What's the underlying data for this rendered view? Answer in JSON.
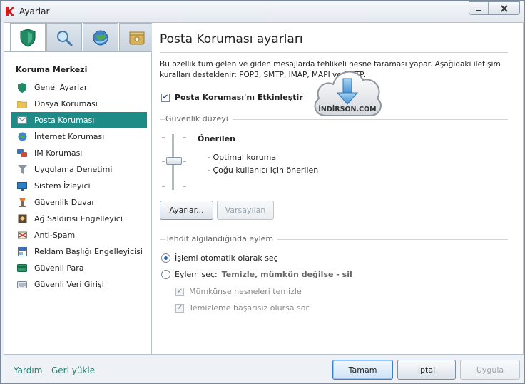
{
  "window": {
    "title": "Ayarlar"
  },
  "sidebar": {
    "section_title": "Koruma Merkezi",
    "items": [
      {
        "label": "Genel Ayarlar",
        "icon": "shield-icon"
      },
      {
        "label": "Dosya Koruması",
        "icon": "folder-icon"
      },
      {
        "label": "Posta Koruması",
        "icon": "mail-icon"
      },
      {
        "label": "İnternet Koruması",
        "icon": "globe-icon"
      },
      {
        "label": "IM Koruması",
        "icon": "chat-icon"
      },
      {
        "label": "Uygulama Denetimi",
        "icon": "funnel-icon"
      },
      {
        "label": "Sistem İzleyici",
        "icon": "monitor-icon"
      },
      {
        "label": "Güvenlik Duvarı",
        "icon": "firewall-icon"
      },
      {
        "label": "Ağ Saldırısı Engelleyici",
        "icon": "network-icon"
      },
      {
        "label": "Anti-Spam",
        "icon": "antispam-icon"
      },
      {
        "label": "Reklam Başlığı Engelleyicisi",
        "icon": "ad-block-icon"
      },
      {
        "label": "Güvenli Para",
        "icon": "money-icon"
      },
      {
        "label": "Güvenli Veri Girişi",
        "icon": "keyboard-icon"
      }
    ],
    "active_index": 2
  },
  "main": {
    "title": "Posta Koruması ayarları",
    "description": "Bu özellik tüm gelen ve giden mesajlarda tehlikeli nesne taraması yapar. Aşağıdaki iletişim kuralları desteklenir: POP3, SMTP, IMAP, MAPI ve NNTP.",
    "enable_label": "Posta Koruması'nı Etkinleştir",
    "security_group": "Güvenlik düzeyi",
    "level_name": "Önerilen",
    "level_lines": [
      "- Optimal koruma",
      "- Çoğu kullanıcı için önerilen"
    ],
    "settings_button": "Ayarlar...",
    "default_button": "Varsayılan",
    "threat_group": "Tehdit algılandığında eylem",
    "radio_auto": "İşlemi otomatik olarak seç",
    "radio_select": "Eylem seç:",
    "radio_select_value": "Temizle, mümkün değilse - sil",
    "sub_check_1": "Mümkünse nesneleri temizle",
    "sub_check_2": "Temizleme başarısız olursa sor"
  },
  "watermark": {
    "text": "İNDİRSON.COM"
  },
  "footer": {
    "help": "Yardım",
    "restore": "Geri yükle",
    "ok": "Tamam",
    "cancel": "İptal",
    "apply": "Uygula"
  }
}
